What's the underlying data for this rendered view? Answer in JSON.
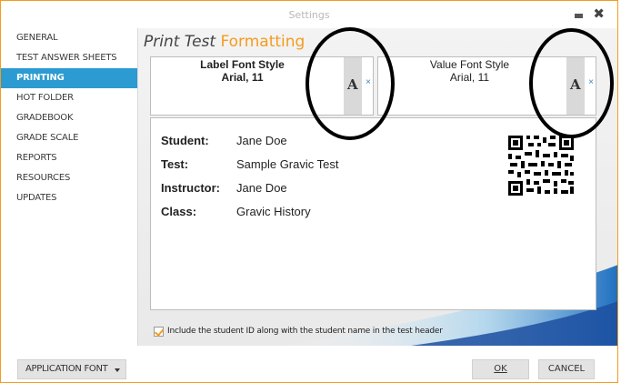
{
  "window": {
    "title": "Settings",
    "minimize_icon": "minimize-icon",
    "close_icon": "close-icon",
    "close_glyph": "✖"
  },
  "sidebar": {
    "items": [
      {
        "label": "GENERAL",
        "active": false
      },
      {
        "label": "TEST ANSWER SHEETS",
        "active": false
      },
      {
        "label": "PRINTING",
        "active": true
      },
      {
        "label": "HOT FOLDER",
        "active": false
      },
      {
        "label": "GRADEBOOK",
        "active": false
      },
      {
        "label": "GRADE SCALE",
        "active": false
      },
      {
        "label": "REPORTS",
        "active": false
      },
      {
        "label": "RESOURCES",
        "active": false
      },
      {
        "label": "UPDATES",
        "active": false
      }
    ],
    "active_color": "#2b9bd2"
  },
  "main": {
    "heading_part1": "Print Test",
    "heading_part2": "Formatting",
    "accent_color": "#f39c1f",
    "label_font": {
      "title": "Label Font Style",
      "value": "Arial, 11",
      "button_glyph": "A",
      "clear_glyph": "×"
    },
    "value_font": {
      "title": "Value Font Style",
      "value": "Arial, 11",
      "button_glyph": "A",
      "clear_glyph": "×"
    },
    "preview": {
      "rows": [
        {
          "key": "Student:",
          "value": "Jane Doe"
        },
        {
          "key": "Test:",
          "value": "Sample Gravic Test"
        },
        {
          "key": "Instructor:",
          "value": "Jane Doe"
        },
        {
          "key": "Class:",
          "value": "Gravic History"
        }
      ],
      "qr_icon": "qr-code-icon"
    },
    "checkbox": {
      "checked": true,
      "label": "Include the student ID along with the student name in the test header"
    }
  },
  "footer": {
    "app_font_label": "APPLICATION FONT",
    "ok_label": "OK",
    "cancel_label": "CANCEL"
  }
}
